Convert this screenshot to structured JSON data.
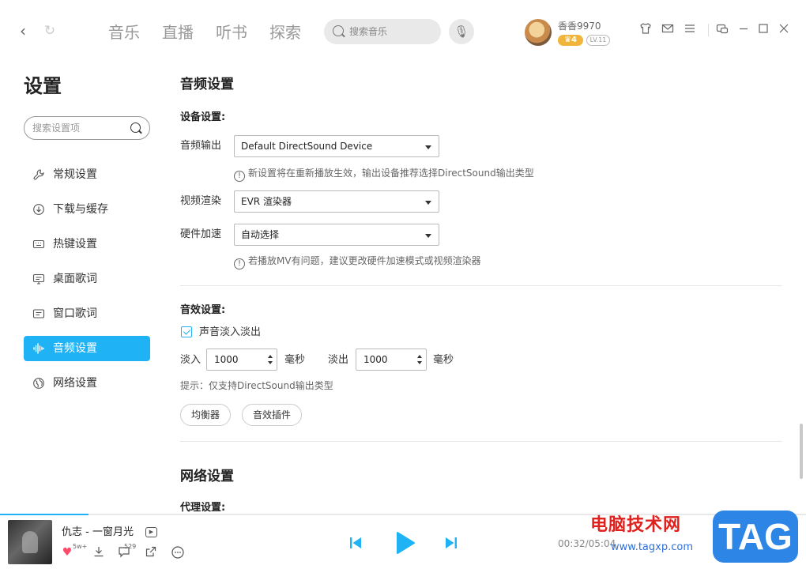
{
  "topbar": {
    "tabs": [
      "音乐",
      "直播",
      "听书",
      "探索"
    ],
    "search_placeholder": "搜索音乐",
    "user": {
      "name": "香香9970",
      "vip_level": "4",
      "lv": "LV.11"
    },
    "icons": [
      "back-icon",
      "refresh-icon",
      "mic-icon",
      "skin-icon",
      "mail-icon",
      "menu-icon",
      "mini-mode-icon",
      "minimize-icon",
      "maximize-icon",
      "close-icon"
    ]
  },
  "sidebar": {
    "title": "设置",
    "search_placeholder": "搜索设置项",
    "items": [
      {
        "label": "常规设置",
        "icon": "wrench-icon"
      },
      {
        "label": "下载与缓存",
        "icon": "download-icon"
      },
      {
        "label": "热键设置",
        "icon": "keyboard-icon"
      },
      {
        "label": "桌面歌词",
        "icon": "desktop-lyrics-icon"
      },
      {
        "label": "窗口歌词",
        "icon": "window-lyrics-icon"
      },
      {
        "label": "音频设置",
        "icon": "audio-wave-icon",
        "active": true
      },
      {
        "label": "网络设置",
        "icon": "globe-icon"
      }
    ]
  },
  "audio": {
    "title": "音频设置",
    "device_section": "设备设置:",
    "output_label": "音频输出",
    "output_value": "Default DirectSound Device",
    "output_hint": "新设置将在重新播放生效，输出设备推荐选择DirectSound输出类型",
    "video_label": "视频渲染",
    "video_value": "EVR 渲染器",
    "hw_label": "硬件加速",
    "hw_value": "自动选择",
    "hw_hint": "若播放MV有问题，建议更改硬件加速模式或视频渲染器",
    "effect_section": "音效设置:",
    "fade_checkbox": "声音淡入淡出",
    "fade_checked": true,
    "fade_in_label": "淡入",
    "fade_in_value": "1000",
    "fade_out_label": "淡出",
    "fade_out_value": "1000",
    "ms_unit": "毫秒",
    "tip": "提示：仅支持DirectSound输出类型",
    "equalizer_button": "均衡器",
    "plugin_button": "音效插件"
  },
  "network": {
    "title": "网络设置",
    "proxy_section": "代理设置:"
  },
  "player": {
    "song": "仇志 - 一窗月光",
    "like_count": "5w+",
    "comment_count": "529",
    "time": "00:32/05:04",
    "progress": 0.11,
    "accent": "#1fb2f5"
  },
  "watermark": {
    "text": "电脑技术网",
    "url": "www.tagxp.com",
    "tag": "TAG"
  }
}
